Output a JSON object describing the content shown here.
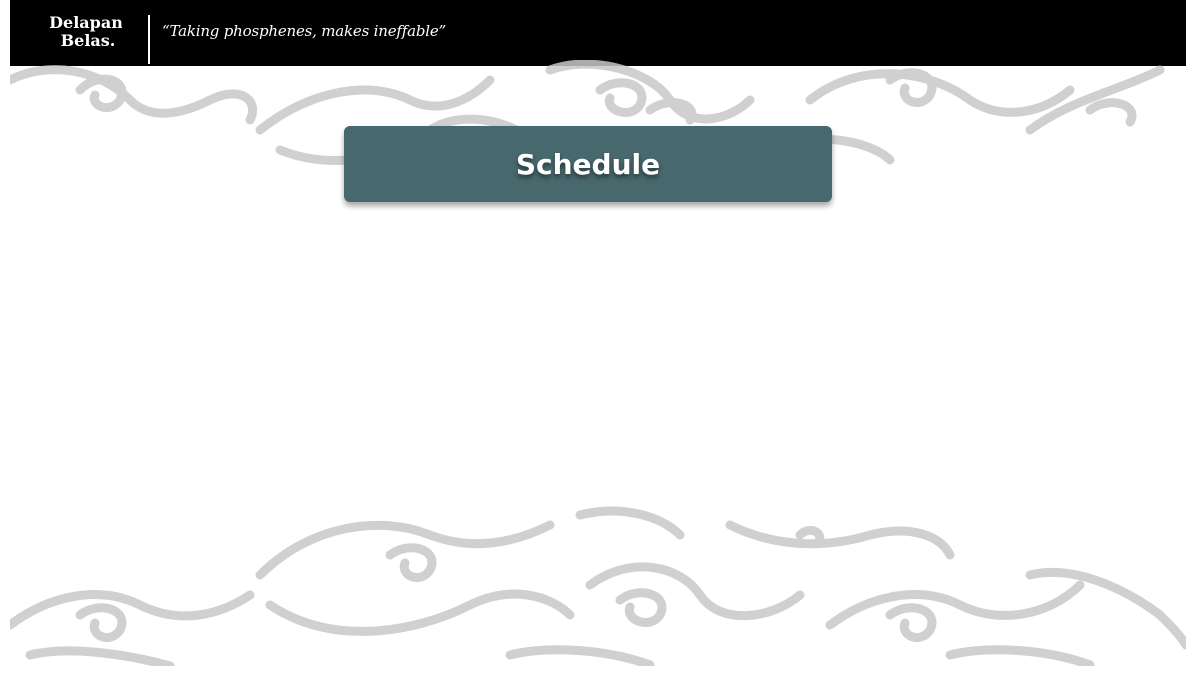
{
  "header": {
    "logo_text_line1": "Delapan",
    "logo_text_line2": "Belas.",
    "tagline": "“Taking phosphenes, makes ineffable”"
  },
  "main": {
    "schedule_label": "Schedule"
  },
  "colors": {
    "header_bg": "#000000",
    "button_bg": "#47686d",
    "batik": "#c8c8c8",
    "page_bg": "#ffffff"
  },
  "icons": [
    "delapan-belas-logo",
    "batik-cloud-pattern"
  ]
}
